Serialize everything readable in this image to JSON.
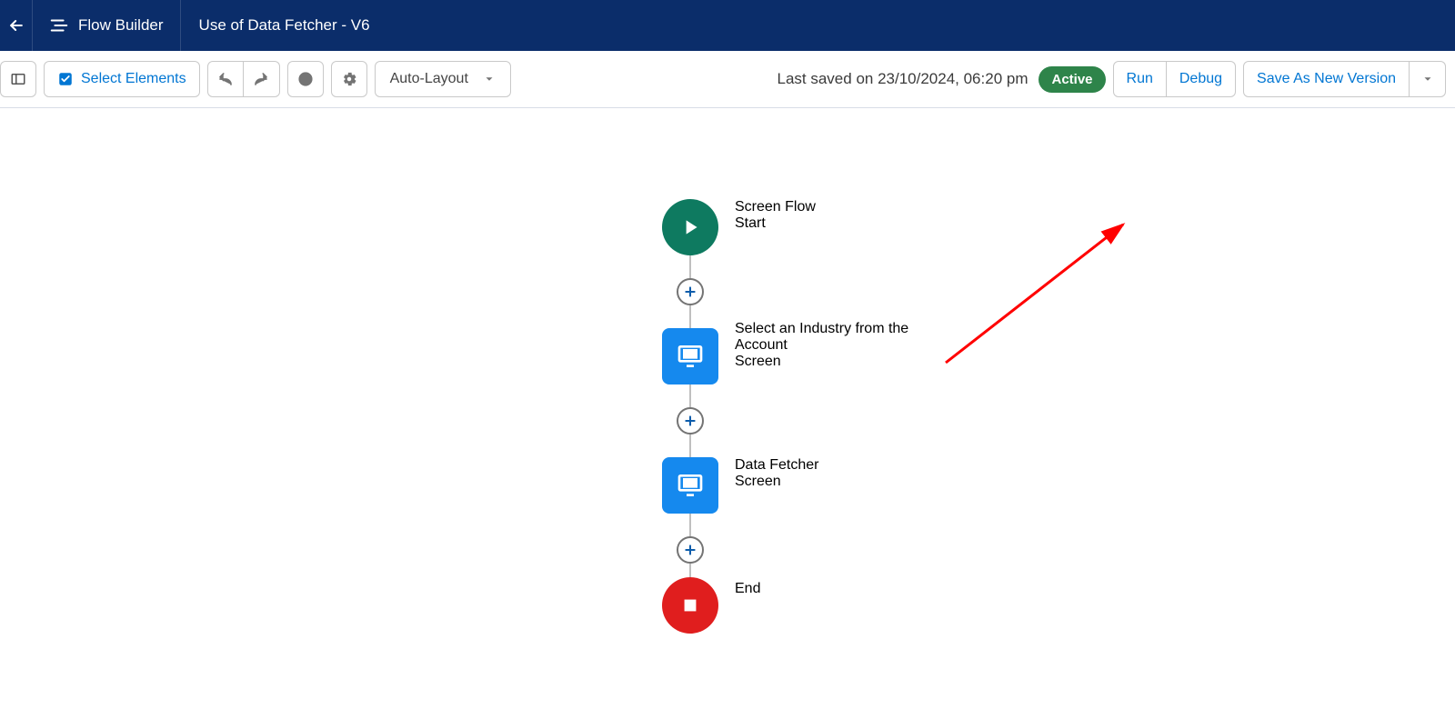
{
  "header": {
    "app_title": "Flow Builder",
    "flow_name": "Use of Data Fetcher - V6"
  },
  "toolbar": {
    "select_elements": "Select Elements",
    "layout_mode": "Auto-Layout",
    "last_saved": "Last saved on 23/10/2024, 06:20 pm",
    "status": "Active",
    "run": "Run",
    "debug": "Debug",
    "save_as": "Save As New Version"
  },
  "flow": {
    "start": {
      "title": "Screen Flow",
      "sub": "Start"
    },
    "n1": {
      "title": "Select an Industry from the Account",
      "sub": "Screen"
    },
    "n2": {
      "title": "Data Fetcher",
      "sub": "Screen"
    },
    "end": {
      "title": "End"
    }
  }
}
